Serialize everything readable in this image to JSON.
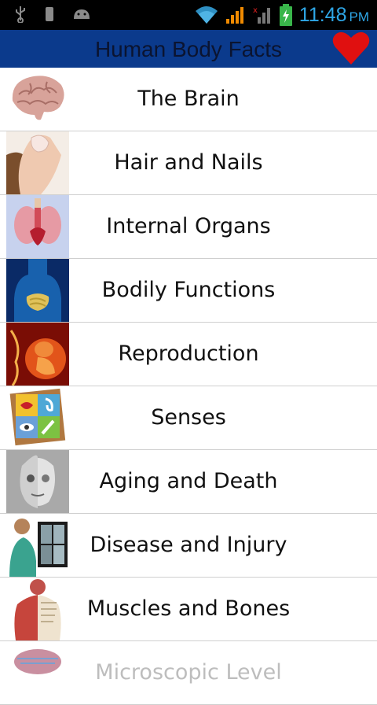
{
  "status_bar": {
    "time": "11:48",
    "ampm": "PM",
    "icons": [
      "usb-icon",
      "sim-icon",
      "android-icon",
      "wifi-icon",
      "signal-icon",
      "no-signal-icon",
      "battery-charging-icon"
    ]
  },
  "app_bar": {
    "title": "Human Body Facts",
    "favorite_icon": "heart-icon"
  },
  "topics": [
    {
      "label": "The Brain",
      "thumb": "brain-thumbnail"
    },
    {
      "label": "Hair and Nails",
      "thumb": "hair-nails-thumbnail"
    },
    {
      "label": "Internal Organs",
      "thumb": "organs-thumbnail"
    },
    {
      "label": "Bodily Functions",
      "thumb": "body-functions-thumbnail"
    },
    {
      "label": "Reproduction",
      "thumb": "reproduction-thumbnail"
    },
    {
      "label": "Senses",
      "thumb": "senses-thumbnail"
    },
    {
      "label": "Aging and Death",
      "thumb": "aging-thumbnail"
    },
    {
      "label": "Disease and Injury",
      "thumb": "disease-thumbnail"
    },
    {
      "label": "Muscles and Bones",
      "thumb": "muscles-thumbnail"
    },
    {
      "label": "Microscopic Level",
      "thumb": "microscopic-thumbnail"
    }
  ]
}
